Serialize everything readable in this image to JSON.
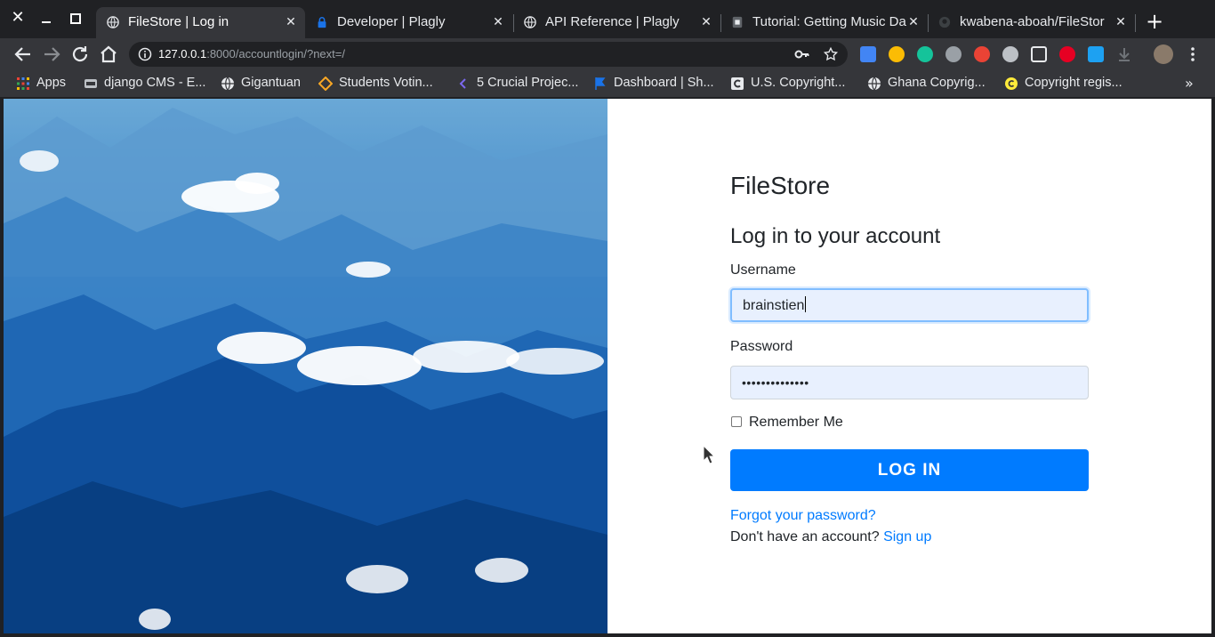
{
  "window_controls": {
    "close": "✕"
  },
  "tabs": [
    {
      "label": "FileStore | Log in",
      "icon": "globe-icon",
      "active": true
    },
    {
      "label": "Developer | Plagly",
      "icon": "lock-icon",
      "active": false
    },
    {
      "label": "API Reference | Plagly",
      "icon": "globe-icon",
      "active": false
    },
    {
      "label": "Tutorial: Getting Music Da",
      "icon": "tutorial-icon",
      "active": false
    },
    {
      "label": "kwabena-aboah/FileStor",
      "icon": "github-icon",
      "active": false
    }
  ],
  "tab_close_glyph": "✕",
  "new_tab_glyph": "+",
  "omnibox": {
    "host": "127.0.0.1",
    "rest": ":8000/accountlogin/?next=/"
  },
  "bookmarks": [
    {
      "label": "Apps",
      "icon": "apps-grid-icon"
    },
    {
      "label": "django CMS - E...",
      "icon": "django-cms-icon"
    },
    {
      "label": "Gigantuan",
      "icon": "globe-icon"
    },
    {
      "label": "Students Votin...",
      "icon": "diamond-icon"
    },
    {
      "label": "5 Crucial Projec...",
      "icon": "chevron-left-icon"
    },
    {
      "label": "Dashboard | Sh...",
      "icon": "flag-icon"
    },
    {
      "label": "U.S. Copyright...",
      "icon": "copyright-icon"
    },
    {
      "label": "Ghana Copyrig...",
      "icon": "globe-icon"
    },
    {
      "label": "Copyright regis...",
      "icon": "copyright-yellow-icon"
    }
  ],
  "bookmarks_more": "»",
  "form": {
    "brand": "FileStore",
    "heading": "Log in to your account",
    "username_label": "Username",
    "username_value": "brainstien",
    "password_label": "Password",
    "password_value": "••••••••••••••",
    "remember_label": "Remember Me",
    "remember_checked": false,
    "login_button": "LOG IN",
    "forgot_link": "Forgot your password?",
    "no_account_text": "Don't have an account?",
    "signup_link": "Sign up"
  },
  "colors": {
    "primary": "#007bff",
    "input_autofill_bg": "#e8f0fe",
    "chrome_dark": "#202124",
    "chrome_toolbar": "#35363a"
  }
}
